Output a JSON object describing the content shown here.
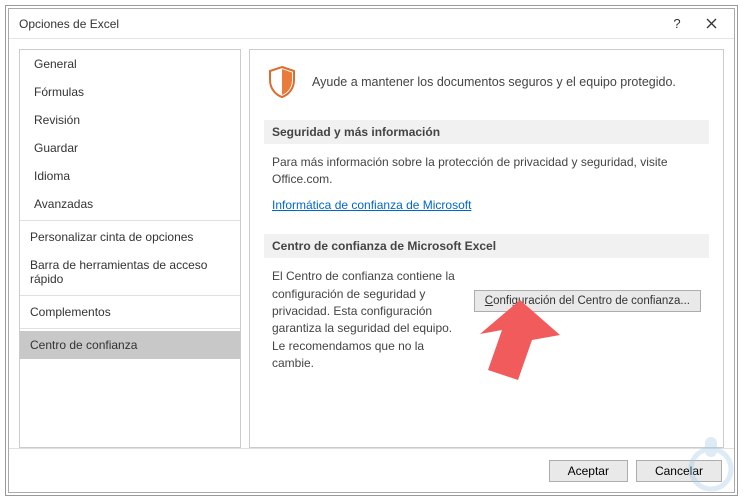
{
  "window": {
    "title": "Opciones de Excel"
  },
  "sidebar": {
    "groups": [
      [
        "General",
        "Fórmulas",
        "Revisión",
        "Guardar",
        "Idioma",
        "Avanzadas"
      ],
      [
        "Personalizar cinta de opciones",
        "Barra de herramientas de acceso rápido"
      ],
      [
        "Complementos"
      ],
      [
        "Centro de confianza"
      ]
    ],
    "selected": "Centro de confianza"
  },
  "content": {
    "hero": "Ayude a mantener los documentos seguros y el equipo protegido.",
    "sec1_head": "Seguridad y más información",
    "sec1_body": "Para más información sobre la protección de privacidad y seguridad, visite Office.com.",
    "sec1_link": "Informática de confianza de Microsoft",
    "sec2_head": "Centro de confianza de Microsoft Excel",
    "sec2_body": "El Centro de confianza contiene la configuración de seguridad y privacidad. Esta configuración garantiza la seguridad del equipo. Le recomendamos que no la cambie.",
    "sec2_button": "Configuración del Centro de confianza..."
  },
  "footer": {
    "ok": "Aceptar",
    "cancel": "Cancelar"
  }
}
